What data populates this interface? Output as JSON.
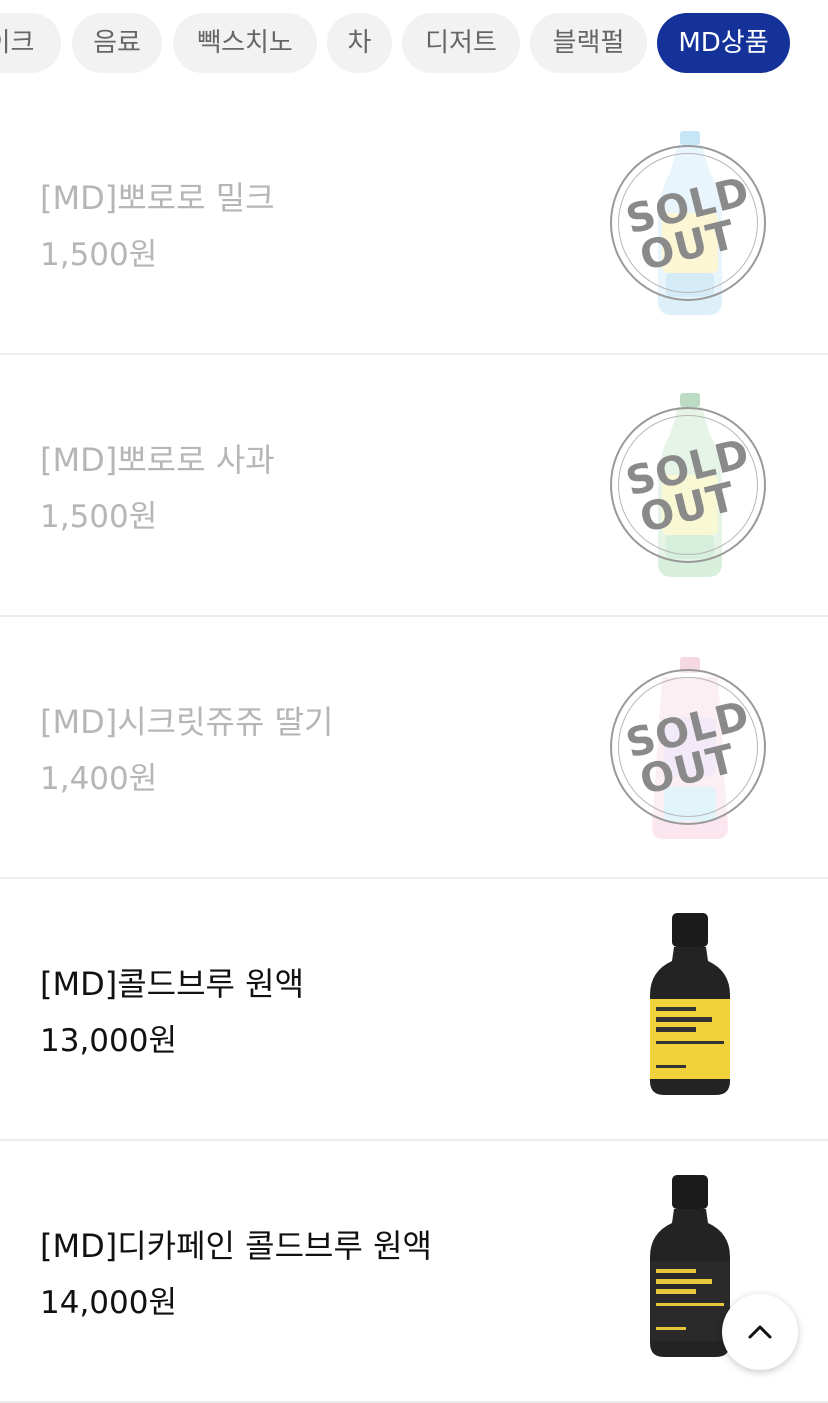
{
  "categories": [
    {
      "label": "이크",
      "active": false
    },
    {
      "label": "음료",
      "active": false
    },
    {
      "label": "빽스치노",
      "active": false
    },
    {
      "label": "차",
      "active": false
    },
    {
      "label": "디저트",
      "active": false
    },
    {
      "label": "블랙펄",
      "active": false
    },
    {
      "label": "MD상품",
      "active": true
    }
  ],
  "sold_out_label": {
    "line1": "SOLD",
    "line2": "OUT"
  },
  "products": [
    {
      "name": "[MD]뽀로로 밀크",
      "price": "1,500원",
      "sold_out": true,
      "icon": "pororo-milk-bottle-icon"
    },
    {
      "name": "[MD]뽀로로 사과",
      "price": "1,500원",
      "sold_out": true,
      "icon": "pororo-apple-bottle-icon"
    },
    {
      "name": "[MD]시크릿쥬쥬 딸기",
      "price": "1,400원",
      "sold_out": true,
      "icon": "secret-jouju-pouch-icon"
    },
    {
      "name": "[MD]콜드브루 원액",
      "price": "13,000원",
      "sold_out": false,
      "icon": "coldbrew-bottle-icon"
    },
    {
      "name": "[MD]디카페인 콜드브루 원액",
      "price": "14,000원",
      "sold_out": false,
      "icon": "decaf-coldbrew-bottle-icon"
    }
  ],
  "colors": {
    "accent": "#14329a",
    "chip_bg": "#f2f2f2",
    "soldout_text": "#b6b6b6"
  },
  "scroll_top_icon": "chevron-up-icon"
}
